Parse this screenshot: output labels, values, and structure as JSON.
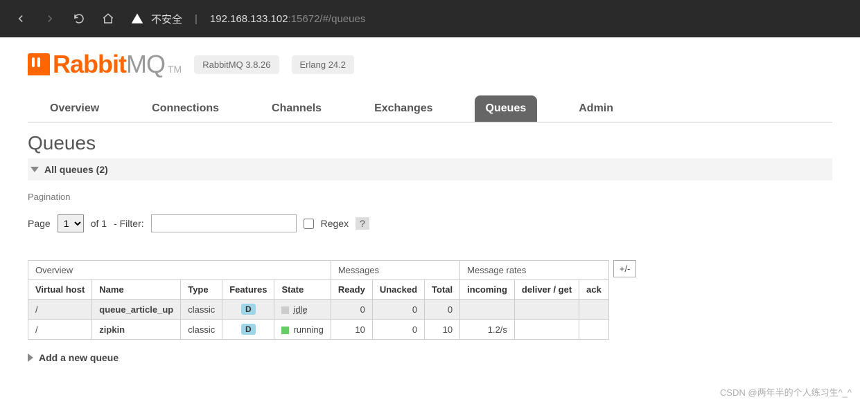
{
  "browser": {
    "insecure_label": "不安全",
    "url_host": "192.168.133.102",
    "url_port_path": ":15672/#/queues"
  },
  "header": {
    "logo_rabbit": "Rabbit",
    "logo_mq": "MQ",
    "logo_tm": "TM",
    "version": "RabbitMQ 3.8.26",
    "erlang": "Erlang 24.2"
  },
  "tabs": [
    {
      "label": "Overview",
      "active": false
    },
    {
      "label": "Connections",
      "active": false
    },
    {
      "label": "Channels",
      "active": false
    },
    {
      "label": "Exchanges",
      "active": false
    },
    {
      "label": "Queues",
      "active": true
    },
    {
      "label": "Admin",
      "active": false
    }
  ],
  "page_title": "Queues",
  "section": {
    "title": "All queues (2)"
  },
  "pagination": {
    "label": "Pagination",
    "page_label": "Page",
    "of_label": "of 1",
    "filter_label": "- Filter:",
    "filter_value": "",
    "regex_label": "Regex",
    "help": "?",
    "page_select": "1"
  },
  "table": {
    "groups": [
      "Overview",
      "Messages",
      "Message rates"
    ],
    "expand": "+/-",
    "cols": [
      "Virtual host",
      "Name",
      "Type",
      "Features",
      "State",
      "Ready",
      "Unacked",
      "Total",
      "incoming",
      "deliver / get",
      "ack"
    ],
    "rows": [
      {
        "vhost": "/",
        "name": "queue_article_up",
        "type": "classic",
        "feat": "D",
        "state": "idle",
        "state_cls": "state-idle",
        "ready": "0",
        "unacked": "0",
        "total": "0",
        "incoming": "",
        "deliver": "",
        "ack": ""
      },
      {
        "vhost": "/",
        "name": "zipkin",
        "type": "classic",
        "feat": "D",
        "state": "running",
        "state_cls": "state-run",
        "ready": "10",
        "unacked": "0",
        "total": "10",
        "incoming": "1.2/s",
        "deliver": "",
        "ack": ""
      }
    ]
  },
  "add_queue": "Add a new queue",
  "watermark": "CSDN @两年半的个人练习生^_^"
}
